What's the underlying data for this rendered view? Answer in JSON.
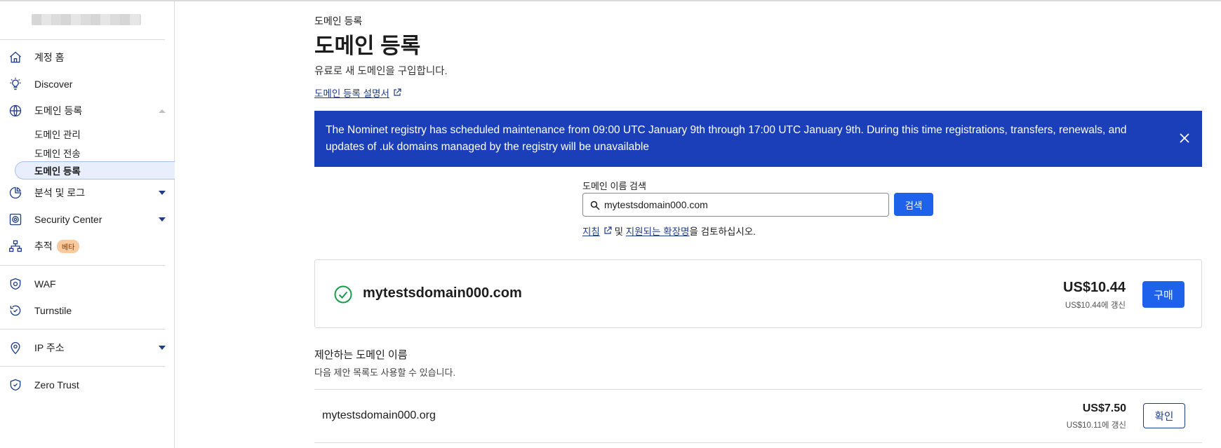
{
  "sidebar": {
    "items": [
      {
        "label": "계정 홈",
        "icon": "home-icon"
      },
      {
        "label": "Discover",
        "icon": "lightbulb-icon"
      },
      {
        "label": "도메인 등록",
        "icon": "globe-icon"
      },
      {
        "label": "분석 및 로그",
        "icon": "pie-chart-icon"
      },
      {
        "label": "Security Center",
        "icon": "security-center-icon"
      },
      {
        "label": "추적",
        "icon": "sitemap-icon",
        "badge": "베타"
      },
      {
        "label": "WAF",
        "icon": "shield-icon"
      },
      {
        "label": "Turnstile",
        "icon": "turnstile-icon"
      },
      {
        "label": "IP 주소",
        "icon": "map-pin-icon"
      },
      {
        "label": "Zero Trust",
        "icon": "zero-trust-icon"
      }
    ],
    "sub_items": [
      {
        "label": "도메인 관리"
      },
      {
        "label": "도메인 전송"
      },
      {
        "label": "도메인 등록"
      }
    ]
  },
  "page": {
    "eyebrow": "도메인 등록",
    "title": "도메인 등록",
    "subtitle": "유료로 새 도메인을 구입합니다.",
    "doc_link": "도메인 등록 설명서"
  },
  "banner": {
    "text": "The Nominet registry has scheduled maintenance from 09:00 UTC January 9th through 17:00 UTC January 9th. During this time registrations, transfers, renewals, and updates of .uk domains managed by the registry will be unavailable"
  },
  "search": {
    "label": "도메인 이름 검색",
    "value": "mytestsdomain000.com",
    "button": "검색",
    "help_link1": "지침",
    "help_and": " 및 ",
    "help_link2": "지원되는 확장명",
    "help_tail": "을 검토하십시오."
  },
  "result": {
    "domain": "mytestsdomain000.com",
    "price": "US$10.44",
    "renew": "US$10.44에 갱신",
    "button": "구매"
  },
  "suggestions": {
    "title": "제안하는 도메인 이름",
    "desc": "다음 제안 목록도 사용할 수 있습니다.",
    "items": [
      {
        "domain": "mytestsdomain000.org",
        "price": "US$7.50",
        "renew": "US$10.11에 갱신",
        "button": "확인"
      }
    ]
  },
  "colors": {
    "banner": "#1a3fb9",
    "primary": "#1e62ec",
    "link": "#1f3c88",
    "success": "#1a9c4b"
  }
}
